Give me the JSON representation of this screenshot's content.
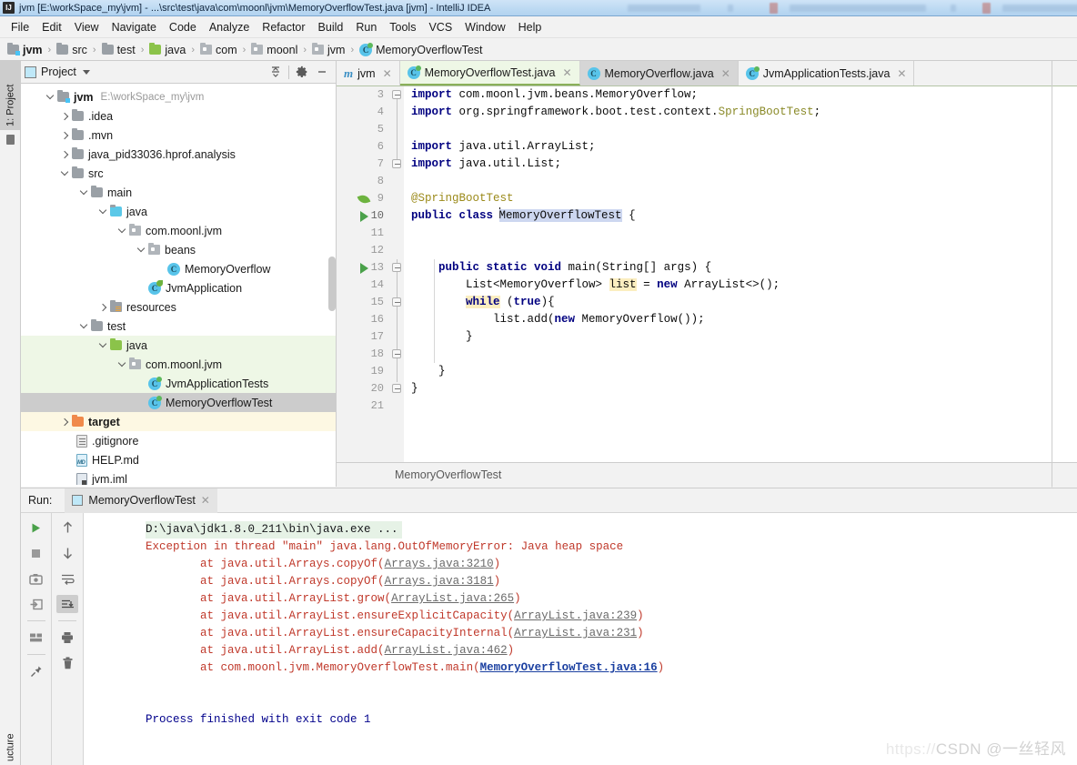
{
  "window": {
    "title": "jvm [E:\\workSpace_my\\jvm] - ...\\src\\test\\java\\com\\moonl\\jvm\\MemoryOverflowTest.java [jvm] - IntelliJ IDEA",
    "app_icon": "intellij-idea-icon"
  },
  "menubar": {
    "items": [
      {
        "label": "File"
      },
      {
        "label": "Edit"
      },
      {
        "label": "View"
      },
      {
        "label": "Navigate"
      },
      {
        "label": "Code"
      },
      {
        "label": "Analyze"
      },
      {
        "label": "Refactor"
      },
      {
        "label": "Build"
      },
      {
        "label": "Run"
      },
      {
        "label": "Tools"
      },
      {
        "label": "VCS"
      },
      {
        "label": "Window"
      },
      {
        "label": "Help"
      }
    ]
  },
  "navbar": {
    "separator": "›",
    "crumbs": [
      {
        "label": "jvm",
        "icon": "module-folder-icon",
        "bold": true
      },
      {
        "label": "src",
        "icon": "folder-icon",
        "bold": false
      },
      {
        "label": "test",
        "icon": "folder-icon",
        "bold": false
      },
      {
        "label": "java",
        "icon": "source-root-folder-icon",
        "bold": false
      },
      {
        "label": "com",
        "icon": "package-icon",
        "bold": false
      },
      {
        "label": "moonl",
        "icon": "package-icon",
        "bold": false
      },
      {
        "label": "jvm",
        "icon": "package-icon",
        "bold": false
      },
      {
        "label": "MemoryOverflowTest",
        "icon": "java-test-class-icon",
        "bold": false
      }
    ]
  },
  "left_strip": {
    "project_tab": "1: Project",
    "structure_tab": "ucture"
  },
  "project_panel": {
    "title": "Project",
    "toolbar": [
      {
        "name": "collapse-all-icon"
      },
      {
        "name": "gear-icon"
      },
      {
        "name": "hide-icon"
      }
    ],
    "tree": [
      {
        "label": "jvm",
        "sub": "E:\\workSpace_my\\jvm",
        "icon": "module-folder-icon",
        "depth": 0,
        "arrow": "down",
        "bold": true,
        "state": ""
      },
      {
        "label": ".idea",
        "sub": "",
        "icon": "folder-icon",
        "depth": 1,
        "arrow": "right",
        "bold": false,
        "state": ""
      },
      {
        "label": ".mvn",
        "sub": "",
        "icon": "folder-icon",
        "depth": 1,
        "arrow": "right",
        "bold": false,
        "state": ""
      },
      {
        "label": "java_pid33036.hprof.analysis",
        "sub": "",
        "icon": "folder-icon",
        "depth": 1,
        "arrow": "right",
        "bold": false,
        "state": ""
      },
      {
        "label": "src",
        "sub": "",
        "icon": "folder-icon",
        "depth": 1,
        "arrow": "down",
        "bold": false,
        "state": ""
      },
      {
        "label": "main",
        "sub": "",
        "icon": "folder-icon",
        "depth": 2,
        "arrow": "down",
        "bold": false,
        "state": ""
      },
      {
        "label": "java",
        "sub": "",
        "icon": "source-root-folder-icon",
        "depth": 3,
        "arrow": "down",
        "bold": false,
        "state": ""
      },
      {
        "label": "com.moonl.jvm",
        "sub": "",
        "icon": "package-icon",
        "depth": 4,
        "arrow": "down",
        "bold": false,
        "state": ""
      },
      {
        "label": "beans",
        "sub": "",
        "icon": "package-icon",
        "depth": 5,
        "arrow": "down",
        "bold": false,
        "state": ""
      },
      {
        "label": "MemoryOverflow",
        "sub": "",
        "icon": "java-class-icon",
        "depth": 6,
        "arrow": "none",
        "bold": false,
        "state": ""
      },
      {
        "label": "JvmApplication",
        "sub": "",
        "icon": "spring-boot-class-icon",
        "depth": 5,
        "arrow": "none",
        "bold": false,
        "state": ""
      },
      {
        "label": "resources",
        "sub": "",
        "icon": "resource-root-folder-icon",
        "depth": 3,
        "arrow": "right",
        "bold": false,
        "state": ""
      },
      {
        "label": "test",
        "sub": "",
        "icon": "folder-icon",
        "depth": 2,
        "arrow": "down",
        "bold": false,
        "state": ""
      },
      {
        "label": "java",
        "sub": "",
        "icon": "test-source-root-folder-icon",
        "depth": 3,
        "arrow": "down",
        "bold": false,
        "state": "green"
      },
      {
        "label": "com.moonl.jvm",
        "sub": "",
        "icon": "package-icon",
        "depth": 4,
        "arrow": "down",
        "bold": false,
        "state": "green"
      },
      {
        "label": "JvmApplicationTests",
        "sub": "",
        "icon": "java-test-class-icon",
        "depth": 5,
        "arrow": "none",
        "bold": false,
        "state": "green"
      },
      {
        "label": "MemoryOverflowTest",
        "sub": "",
        "icon": "java-test-class-icon",
        "depth": 5,
        "arrow": "none",
        "bold": false,
        "state": "selected"
      },
      {
        "label": "target",
        "sub": "",
        "icon": "excluded-folder-icon",
        "depth": 1,
        "arrow": "right",
        "bold": false,
        "state": "yellow"
      },
      {
        "label": ".gitignore",
        "sub": "",
        "icon": "file-icon",
        "depth": 1,
        "arrow": "none",
        "bold": false,
        "state": ""
      },
      {
        "label": "HELP.md",
        "sub": "",
        "icon": "markdown-file-icon",
        "depth": 1,
        "arrow": "none",
        "bold": false,
        "state": ""
      },
      {
        "label": "jvm.iml",
        "sub": "",
        "icon": "iml-file-icon",
        "depth": 1,
        "arrow": "none",
        "bold": false,
        "state": ""
      }
    ]
  },
  "editor": {
    "tabs": [
      {
        "label": "jvm",
        "icon": "maven-module-icon",
        "state": "plain"
      },
      {
        "label": "MemoryOverflowTest.java",
        "icon": "java-test-class-icon",
        "state": "active"
      },
      {
        "label": "MemoryOverflow.java",
        "icon": "java-class-icon",
        "state": "gray"
      },
      {
        "label": "JvmApplicationTests.java",
        "icon": "java-test-class-icon",
        "state": "plain"
      }
    ],
    "breadcrumb": "MemoryOverflowTest",
    "lines": [
      {
        "no": "3",
        "gutter": "",
        "fold": "fold-end"
      },
      {
        "no": "4",
        "gutter": "",
        "fold": ""
      },
      {
        "no": "5",
        "gutter": "",
        "fold": ""
      },
      {
        "no": "6",
        "gutter": "",
        "fold": ""
      },
      {
        "no": "7",
        "gutter": "",
        "fold": "fold-end"
      },
      {
        "no": "8",
        "gutter": "",
        "fold": ""
      },
      {
        "no": "9",
        "gutter": "spring-leaf-icon",
        "fold": ""
      },
      {
        "no": "10",
        "gutter": "run-class-icon",
        "fold": "",
        "highlight": true
      },
      {
        "no": "11",
        "gutter": "",
        "fold": ""
      },
      {
        "no": "12",
        "gutter": "",
        "fold": ""
      },
      {
        "no": "13",
        "gutter": "run-method-icon",
        "fold": "fold-open"
      },
      {
        "no": "14",
        "gutter": "",
        "fold": ""
      },
      {
        "no": "15",
        "gutter": "",
        "fold": "fold-open"
      },
      {
        "no": "16",
        "gutter": "",
        "fold": ""
      },
      {
        "no": "17",
        "gutter": "",
        "fold": "fold-end"
      },
      {
        "no": "18",
        "gutter": "",
        "fold": ""
      },
      {
        "no": "19",
        "gutter": "",
        "fold": "fold-end"
      },
      {
        "no": "20",
        "gutter": "",
        "fold": ""
      },
      {
        "no": "21",
        "gutter": "",
        "fold": ""
      }
    ],
    "code_text": [
      "import com.moonl.jvm.beans.MemoryOverflow;",
      "import org.springframework.boot.test.context.SpringBootTest;",
      "",
      "import java.util.ArrayList;",
      "import java.util.List;",
      "",
      "@SpringBootTest",
      "public class MemoryOverflowTest {",
      "",
      "",
      "    public static void main(String[] args) {",
      "        List<MemoryOverflow> list = new ArrayList<>();",
      "        while (true){",
      "            list.add(new MemoryOverflow());",
      "        }",
      "",
      "    }",
      "}",
      ""
    ]
  },
  "run_window": {
    "label": "Run:",
    "tab": "MemoryOverflowTest",
    "toolbar_left": [
      {
        "name": "rerun-icon"
      },
      {
        "name": "stop-icon"
      },
      {
        "name": "camera-icon"
      },
      {
        "name": "export-icon"
      },
      {
        "name": "layout-icon"
      },
      {
        "name": "pin-icon"
      }
    ],
    "toolbar_right": [
      {
        "name": "up-arrow-icon"
      },
      {
        "name": "down-arrow-icon"
      },
      {
        "name": "soft-wrap-icon"
      },
      {
        "name": "scroll-to-end-icon"
      },
      {
        "name": "print-icon"
      },
      {
        "name": "trash-icon"
      }
    ],
    "console": [
      {
        "text": "D:\\java\\jdk1.8.0_211\\bin\\java.exe ...",
        "kind": "cmd"
      },
      {
        "text": "Exception in thread \"main\" java.lang.OutOfMemoryError: Java heap space",
        "kind": "err"
      },
      {
        "pre": "\tat java.util.Arrays.copyOf(",
        "link": "Arrays.java:3210",
        "post": ")",
        "kind": "trace"
      },
      {
        "pre": "\tat java.util.Arrays.copyOf(",
        "link": "Arrays.java:3181",
        "post": ")",
        "kind": "trace"
      },
      {
        "pre": "\tat java.util.ArrayList.grow(",
        "link": "ArrayList.java:265",
        "post": ")",
        "kind": "trace"
      },
      {
        "pre": "\tat java.util.ArrayList.ensureExplicitCapacity(",
        "link": "ArrayList.java:239",
        "post": ")",
        "kind": "trace"
      },
      {
        "pre": "\tat java.util.ArrayList.ensureCapacityInternal(",
        "link": "ArrayList.java:231",
        "post": ")",
        "kind": "trace"
      },
      {
        "pre": "\tat java.util.ArrayList.add(",
        "link": "ArrayList.java:462",
        "post": ")",
        "kind": "trace"
      },
      {
        "pre": "\tat com.moonl.jvm.MemoryOverflowTest.main(",
        "link": "MemoryOverflowTest.java:16",
        "post": ")",
        "kind": "trace-main"
      },
      {
        "text": "",
        "kind": "blank"
      },
      {
        "text": "Process finished with exit code 1",
        "kind": "ok"
      }
    ]
  },
  "watermark": {
    "faint_prefix": "https://",
    "text": "CSDN @一丝轻风"
  },
  "colors": {
    "accent_green": "#6db33f",
    "selection": "#cccccc",
    "test_root_green": "#eef7e6",
    "highlight_line": "#fdf8e3",
    "error_red": "#c0392b",
    "keyword_blue": "#000080"
  }
}
